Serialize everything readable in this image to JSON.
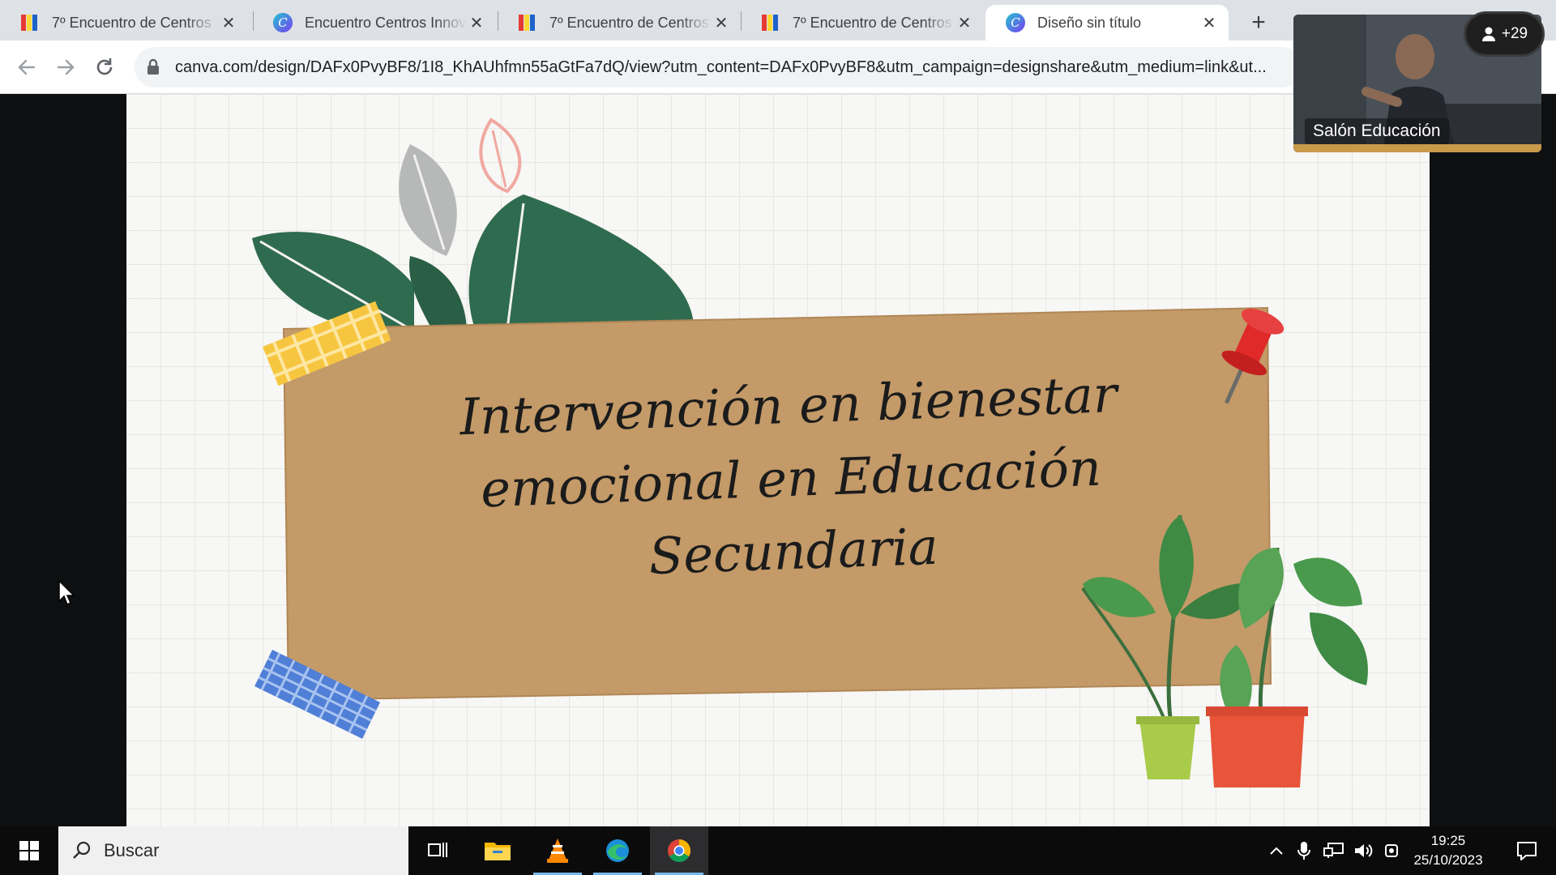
{
  "browser": {
    "tabs": [
      {
        "title": "7º Encuentro de Centros",
        "favicon": "colored-logo-icon",
        "active": false
      },
      {
        "title": "Encuentro Centros Innov",
        "favicon": "canva-icon",
        "active": false
      },
      {
        "title": "7º Encuentro de Centros",
        "favicon": "colored-logo-icon",
        "active": false
      },
      {
        "title": "7º Encuentro de Centros",
        "favicon": "colored-logo-icon",
        "active": false
      },
      {
        "title": "Diseño sin título",
        "favicon": "canva-icon",
        "active": true
      }
    ],
    "url": "canva.com/design/DAFx0PvyBF8/1I8_KhAUhfmn55aGtFa7dQ/view?utm_content=DAFx0PvyBF8&utm_campaign=designshare&utm_medium=link&ut..."
  },
  "video": {
    "participant_name": "Salón Educación",
    "participant_count": "+29"
  },
  "slide": {
    "title_lines": [
      "Intervención en bienestar",
      "emocional en Educación",
      "Secundaria"
    ],
    "colors": {
      "kraft": "#c39a68",
      "leaf": "#2f6b4f",
      "pot_red": "#e8553a",
      "pot_green": "#a9cb4a",
      "pin": "#e02a2a"
    }
  },
  "taskbar": {
    "search_placeholder": "Buscar",
    "time": "19:25",
    "date": "25/10/2023",
    "apps": [
      "task-view-icon",
      "file-explorer-icon",
      "vlc-icon",
      "edge-icon",
      "chrome-icon"
    ]
  }
}
